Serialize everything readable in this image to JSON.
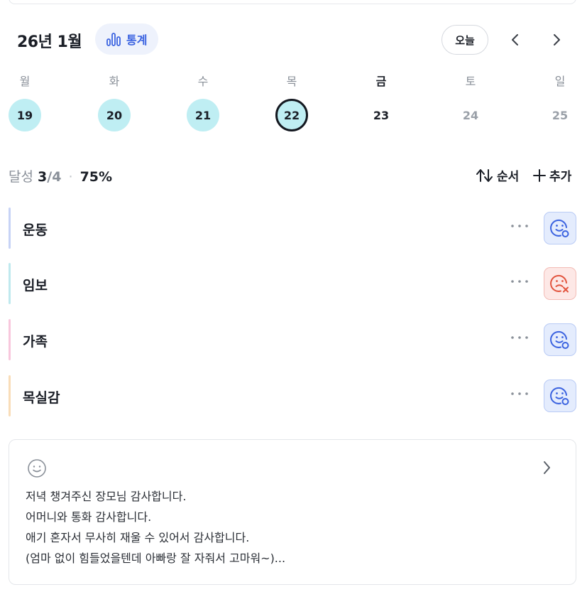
{
  "header": {
    "month": "26년 1월",
    "stats_label": "통계",
    "today_label": "오늘"
  },
  "week": {
    "weekdays": [
      "월",
      "화",
      "수",
      "목",
      "금",
      "토",
      "일"
    ],
    "days": [
      "19",
      "20",
      "21",
      "22",
      "23",
      "24",
      "25"
    ]
  },
  "summary": {
    "prefix": "달성",
    "done": "3",
    "total": "/4",
    "separator": "·",
    "percent": "75%"
  },
  "actions": {
    "order_label": "순서",
    "add_label": "추가"
  },
  "habits": [
    {
      "name": "운동",
      "color": "#c7d3f6",
      "status": "done"
    },
    {
      "name": "임보",
      "color": "#bfe9ee",
      "status": "failed"
    },
    {
      "name": "가족",
      "color": "#f8c7dd",
      "status": "done"
    },
    {
      "name": "목실감",
      "color": "#f9ddb8",
      "status": "done"
    }
  ],
  "journal": {
    "lines": [
      "저녁 챙겨주신 장모님 감사합니다.",
      "어머니와 통화 감사합니다.",
      "애기 혼자서 무사히 재울 수 있어서 감사합니다.",
      "(엄마 없이 힘들었을텐데 아빠랑 잘 자줘서 고마워~)..."
    ]
  },
  "colors": {
    "accent": "#3b63e0",
    "done_day": "#bfeef3",
    "fail": "#e2553f"
  }
}
